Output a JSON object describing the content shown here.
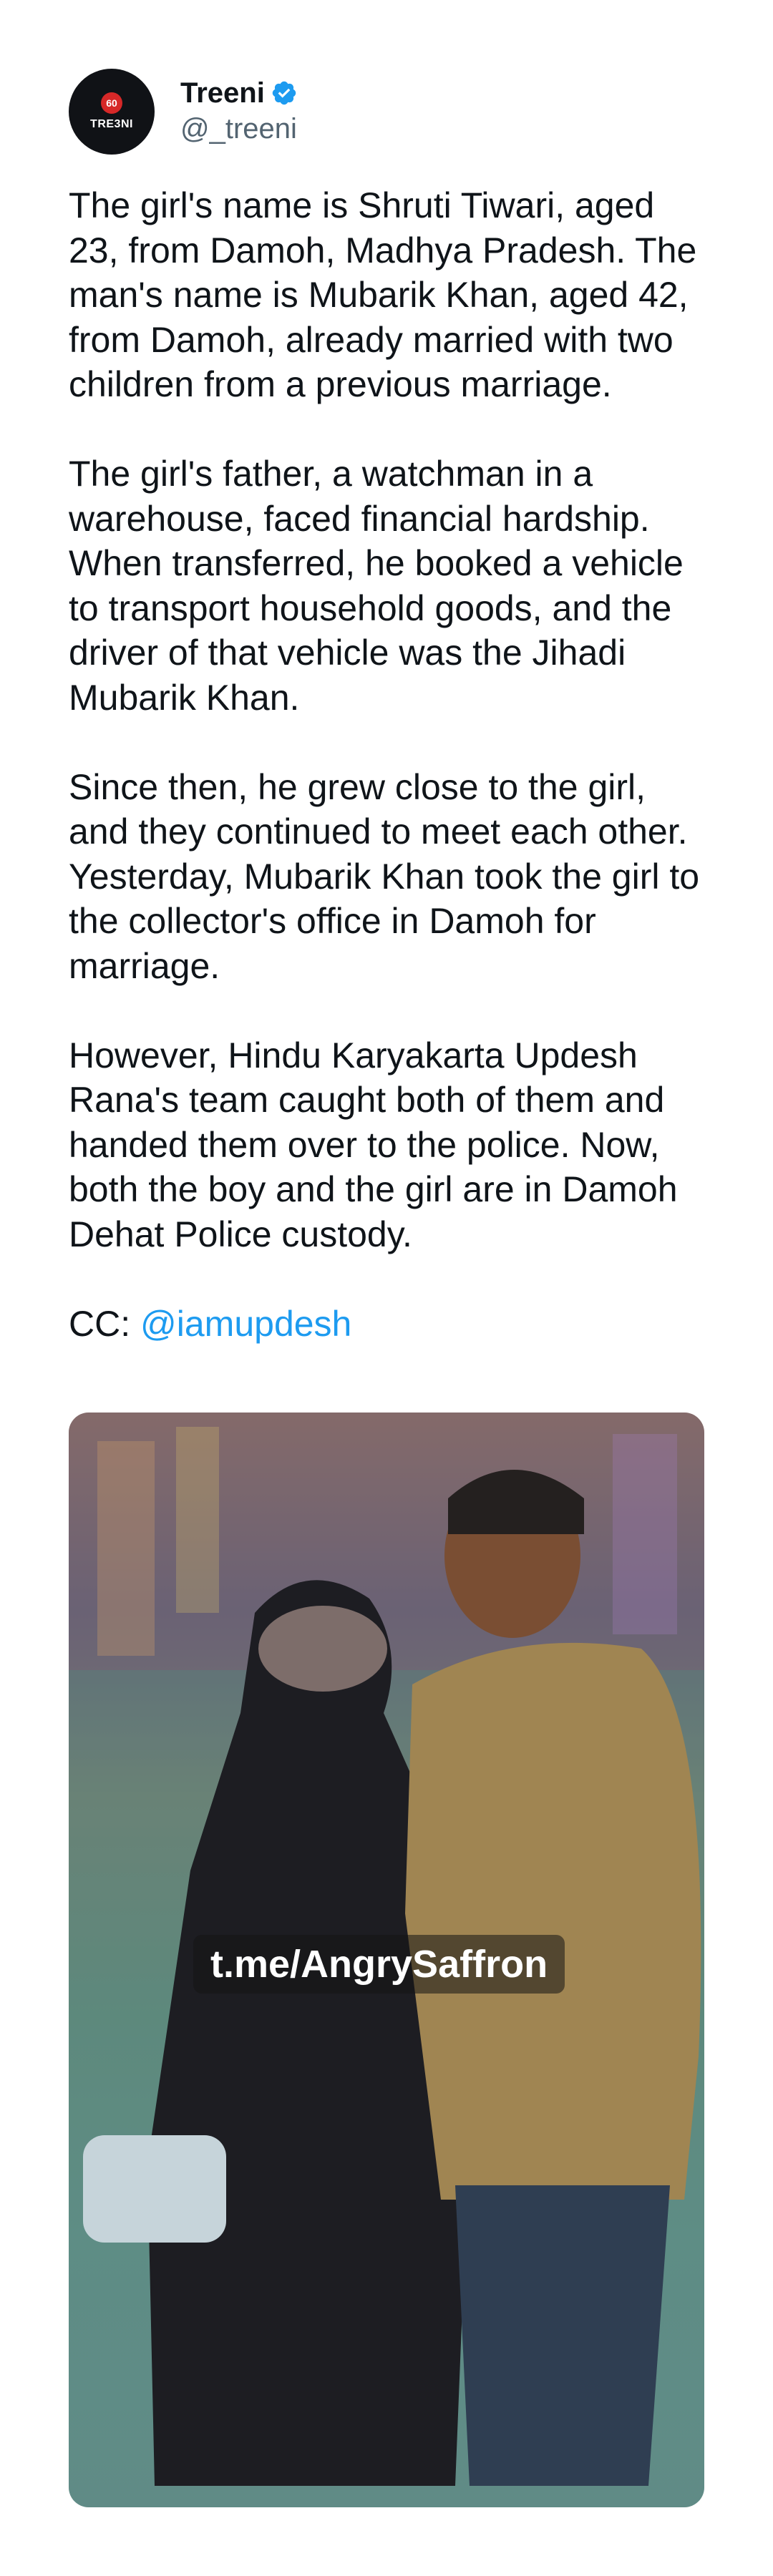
{
  "author": {
    "display_name": "Treeni",
    "handle": "@_treeni",
    "avatar_badge": "60",
    "avatar_logo_text": "TRE3NI"
  },
  "tweet": {
    "paragraphs": [
      "The girl's name is Shruti Tiwari, aged 23, from Damoh, Madhya Pradesh. The man's name is Mubarik Khan, aged 42, from Damoh, already married with two children from a previous marriage.",
      "The girl's father, a watchman in a warehouse, faced financial hardship. When transferred, he booked a vehicle to transport household goods, and the driver of that vehicle was the Jihadi Mubarik Khan.",
      "Since then, he grew close to the girl, and they continued to meet each other. Yesterday, Mubarik Khan took the girl to the collector's office in Damoh for marriage.",
      "However,  Hindu Karyakarta Updesh Rana's team caught both of them and handed them over to the police. Now, both the boy and the girl are in Damoh Dehat Police custody."
    ],
    "cc_label": "CC: ",
    "cc_mention": "@iamupdesh"
  },
  "media": {
    "watermark": "t.me/AngrySaffron"
  },
  "colors": {
    "link": "#1d9bf0",
    "verified": "#1d9bf0",
    "handle": "#536471"
  }
}
